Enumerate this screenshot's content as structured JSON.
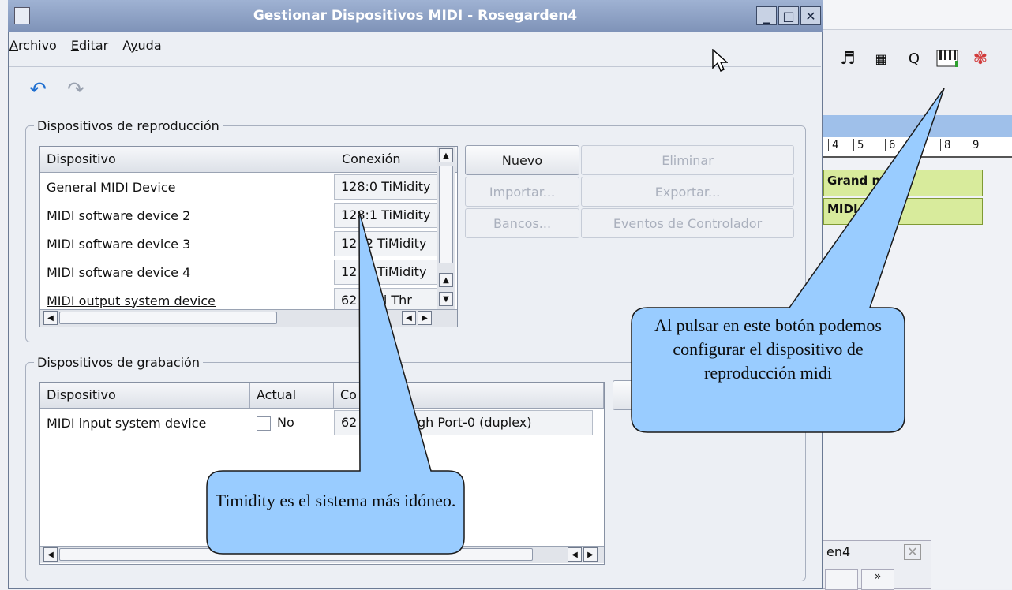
{
  "window": {
    "title": "Gestionar Dispositivos MIDI - Rosegarden4"
  },
  "menu": [
    {
      "label": "Archivo",
      "underline": "A",
      "rest": "rchivo"
    },
    {
      "label": "Editar",
      "underline": "E",
      "rest": "ditar"
    },
    {
      "label": "Ayuda",
      "underline": "y",
      "pre": "A",
      "rest": "uda"
    }
  ],
  "playback": {
    "legend": "Dispositivos de reproducción",
    "columns": [
      "Dispositivo",
      "Conexión"
    ],
    "rows": [
      {
        "device": "General MIDI Device",
        "connection": "128:0 TiMidity"
      },
      {
        "device": "MIDI software device 2",
        "connection": "128:1 TiMidity"
      },
      {
        "device": "MIDI software device 3",
        "connection": "12 :2 TiMidity"
      },
      {
        "device": "MIDI software device 4",
        "connection": "12 :3 TiMidity"
      },
      {
        "device": "MIDI output system device",
        "connection": "62 Midi Thr"
      }
    ],
    "buttons": {
      "new": "Nuevo",
      "delete": "Eliminar",
      "import": "Importar...",
      "export": "Exportar...",
      "banks": "Bancos...",
      "controller_events": "Eventos de Controlador"
    }
  },
  "recording": {
    "legend": "Dispositivos de grabación",
    "columns": [
      "Dispositivo",
      "Actual",
      "Co",
      "n"
    ],
    "rows": [
      {
        "device": "MIDI input system device",
        "current": "No",
        "connection": "62      Through Port-0 (duplex)"
      }
    ],
    "partial_button": "N"
  },
  "background_app": {
    "title_fragment": "en4",
    "ruler": [
      "4",
      "5",
      "6",
      "7",
      "8",
      "9"
    ],
    "segments": [
      "Grand     no",
      "MIDI      ce #2"
    ]
  },
  "callouts": {
    "right": "Al pulsar en este botón podemos configurar el dispositivo de reproducción midi",
    "left": "Timidity es el sistema más idóneo."
  },
  "colors": {
    "callout_fill": "#99ccff",
    "segment_fill": "#d8eb9c",
    "title_bar": "#8ea2c6"
  }
}
